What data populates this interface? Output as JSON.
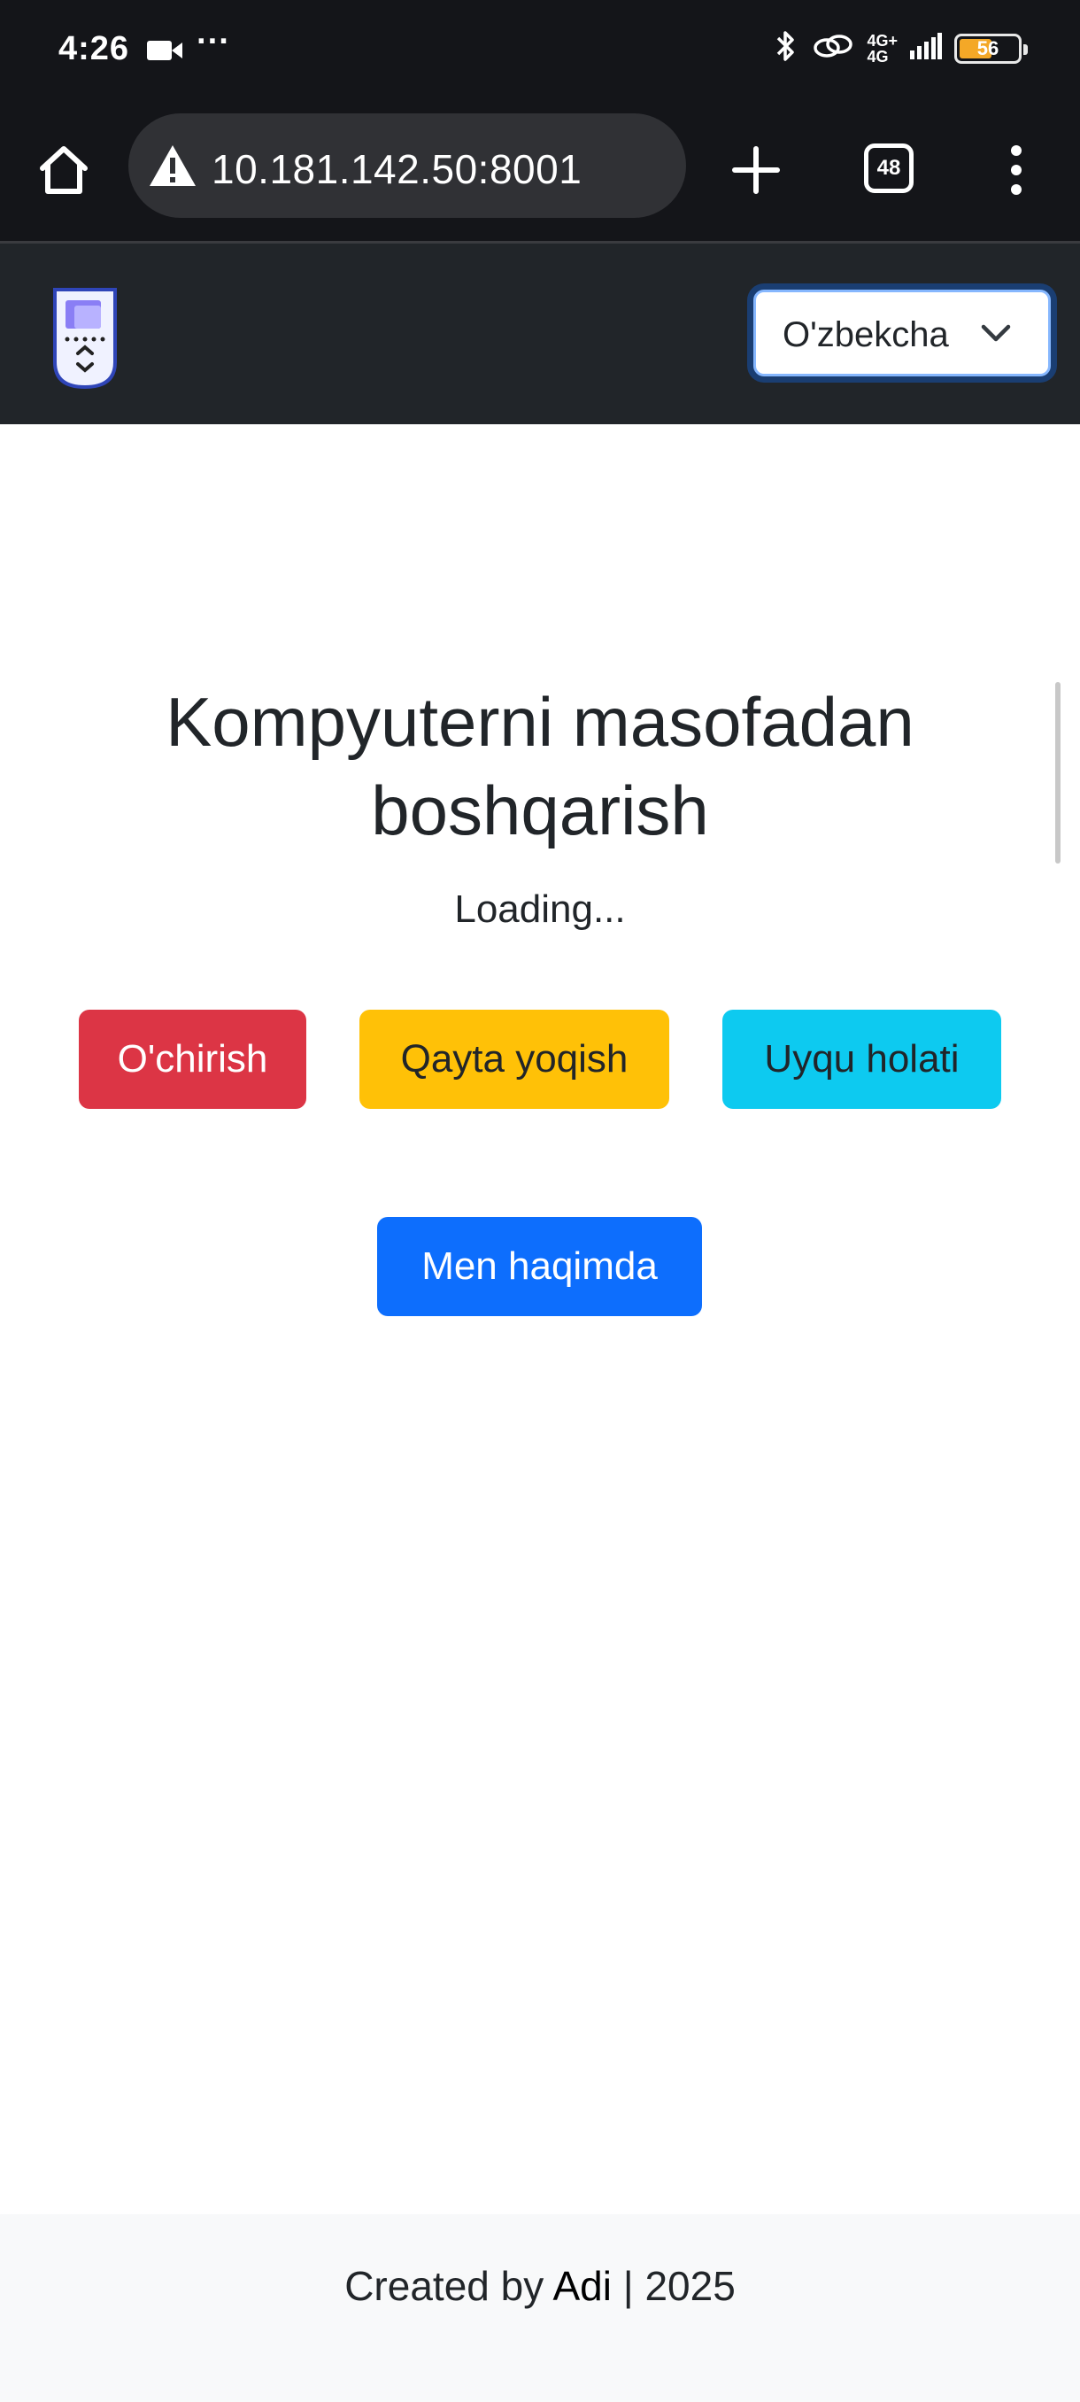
{
  "status_bar": {
    "time": "4:26",
    "dots": "···",
    "network_top": "4G+",
    "network_bottom": "4G",
    "battery": "56",
    "battery_level": 0.56
  },
  "browser": {
    "url": "10.181.142.50:8001",
    "tab_count": "48"
  },
  "navbar": {
    "language": "O'zbekcha"
  },
  "main": {
    "title": "Kompyuterni masofadan boshqarish",
    "loading": "Loading...",
    "buttons": {
      "shutdown": "O'chirish",
      "restart": "Qayta yoqish",
      "sleep": "Uyqu holati",
      "about": "Men haqimda"
    }
  },
  "footer": {
    "prefix": "Created by ",
    "author": "Adi",
    "suffix": " | 2025"
  },
  "colors": {
    "danger": "#dc3545",
    "warning": "#ffc107",
    "info": "#0dcaf0",
    "primary": "#0d6efd",
    "navbar": "#212529"
  }
}
